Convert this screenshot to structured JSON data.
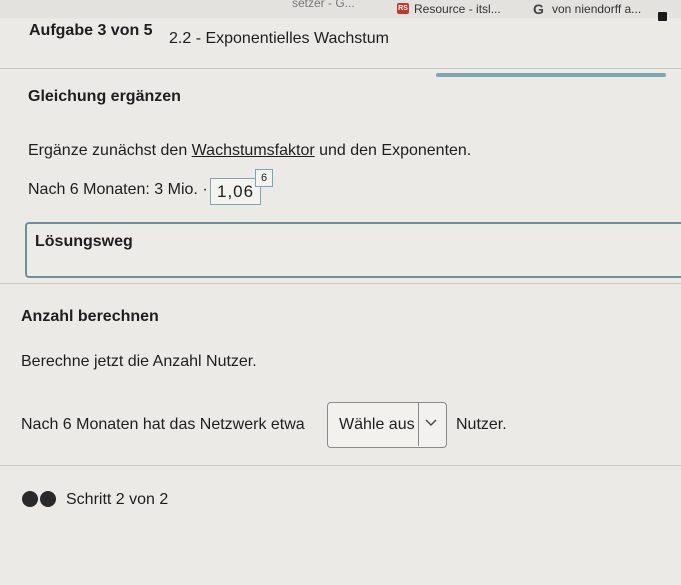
{
  "bookmarks": {
    "item1_label": "setzer - G...",
    "item2_label": "Resource - itsl...",
    "item2_icon": "RS",
    "item3_label": "von niendorff a...",
    "item3_icon": "G"
  },
  "task": {
    "counter": "Aufgabe 3 von 5",
    "title": "2.2 - Exponentielles Wachstum"
  },
  "section1": {
    "title": "Gleichung ergänzen",
    "instruction_prefix": "Ergänze zunächst den ",
    "instruction_link": "Wachstumsfaktor",
    "instruction_suffix": " und den Exponenten.",
    "equation_prefix": "Nach 6 Monaten: 3 Mio. ·",
    "factor_value": "1,06",
    "exponent_value": "6"
  },
  "loesungsweg": {
    "label": "Lösungsweg"
  },
  "section2": {
    "title": "Anzahl berechnen",
    "instruction": "Berechne jetzt die Anzahl Nutzer.",
    "sentence_prefix": "Nach 6 Monaten hat das Netzwerk etwa",
    "select_placeholder": "Wähle aus",
    "sentence_suffix": "Nutzer."
  },
  "step_indicator": {
    "label": "Schritt 2 von 2"
  },
  "colors": {
    "accent": "#7fa6b0",
    "progress": "#7ea7b3"
  }
}
